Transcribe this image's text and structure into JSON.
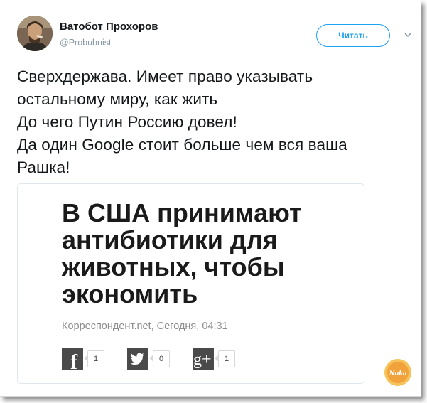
{
  "author": {
    "name": "Ватобот Прохоров",
    "handle": "@Probubnist"
  },
  "follow_button": {
    "label": "Читать"
  },
  "tweet": {
    "lines": [
      "Сверхдержава. Имеет право указывать",
      "остальному миру, как жить",
      "До чего Путин Россию довел!",
      "Да один Google стоит больше чем вся ваша",
      "Рашка!"
    ]
  },
  "card": {
    "headline_lines": [
      "В США принимают",
      "антибиотики для",
      "животных, чтобы",
      "экономить"
    ],
    "meta": "Корреспондент.net, Сегодня, 04:31",
    "shares": [
      {
        "network": "facebook",
        "icon": "facebook-icon",
        "glyph": "f",
        "count": "1"
      },
      {
        "network": "twitter",
        "icon": "twitter-icon",
        "glyph": "",
        "count": "0"
      },
      {
        "network": "google-plus",
        "icon": "google-plus-icon",
        "glyph": "g+",
        "count": "1"
      }
    ]
  },
  "watermark": {
    "text": "Nuka"
  },
  "colors": {
    "accent": "#1da1f2",
    "text": "#14171a",
    "muted": "#8899a6",
    "share_icon": "#4a4a4a",
    "watermark": "#f2a23a"
  }
}
